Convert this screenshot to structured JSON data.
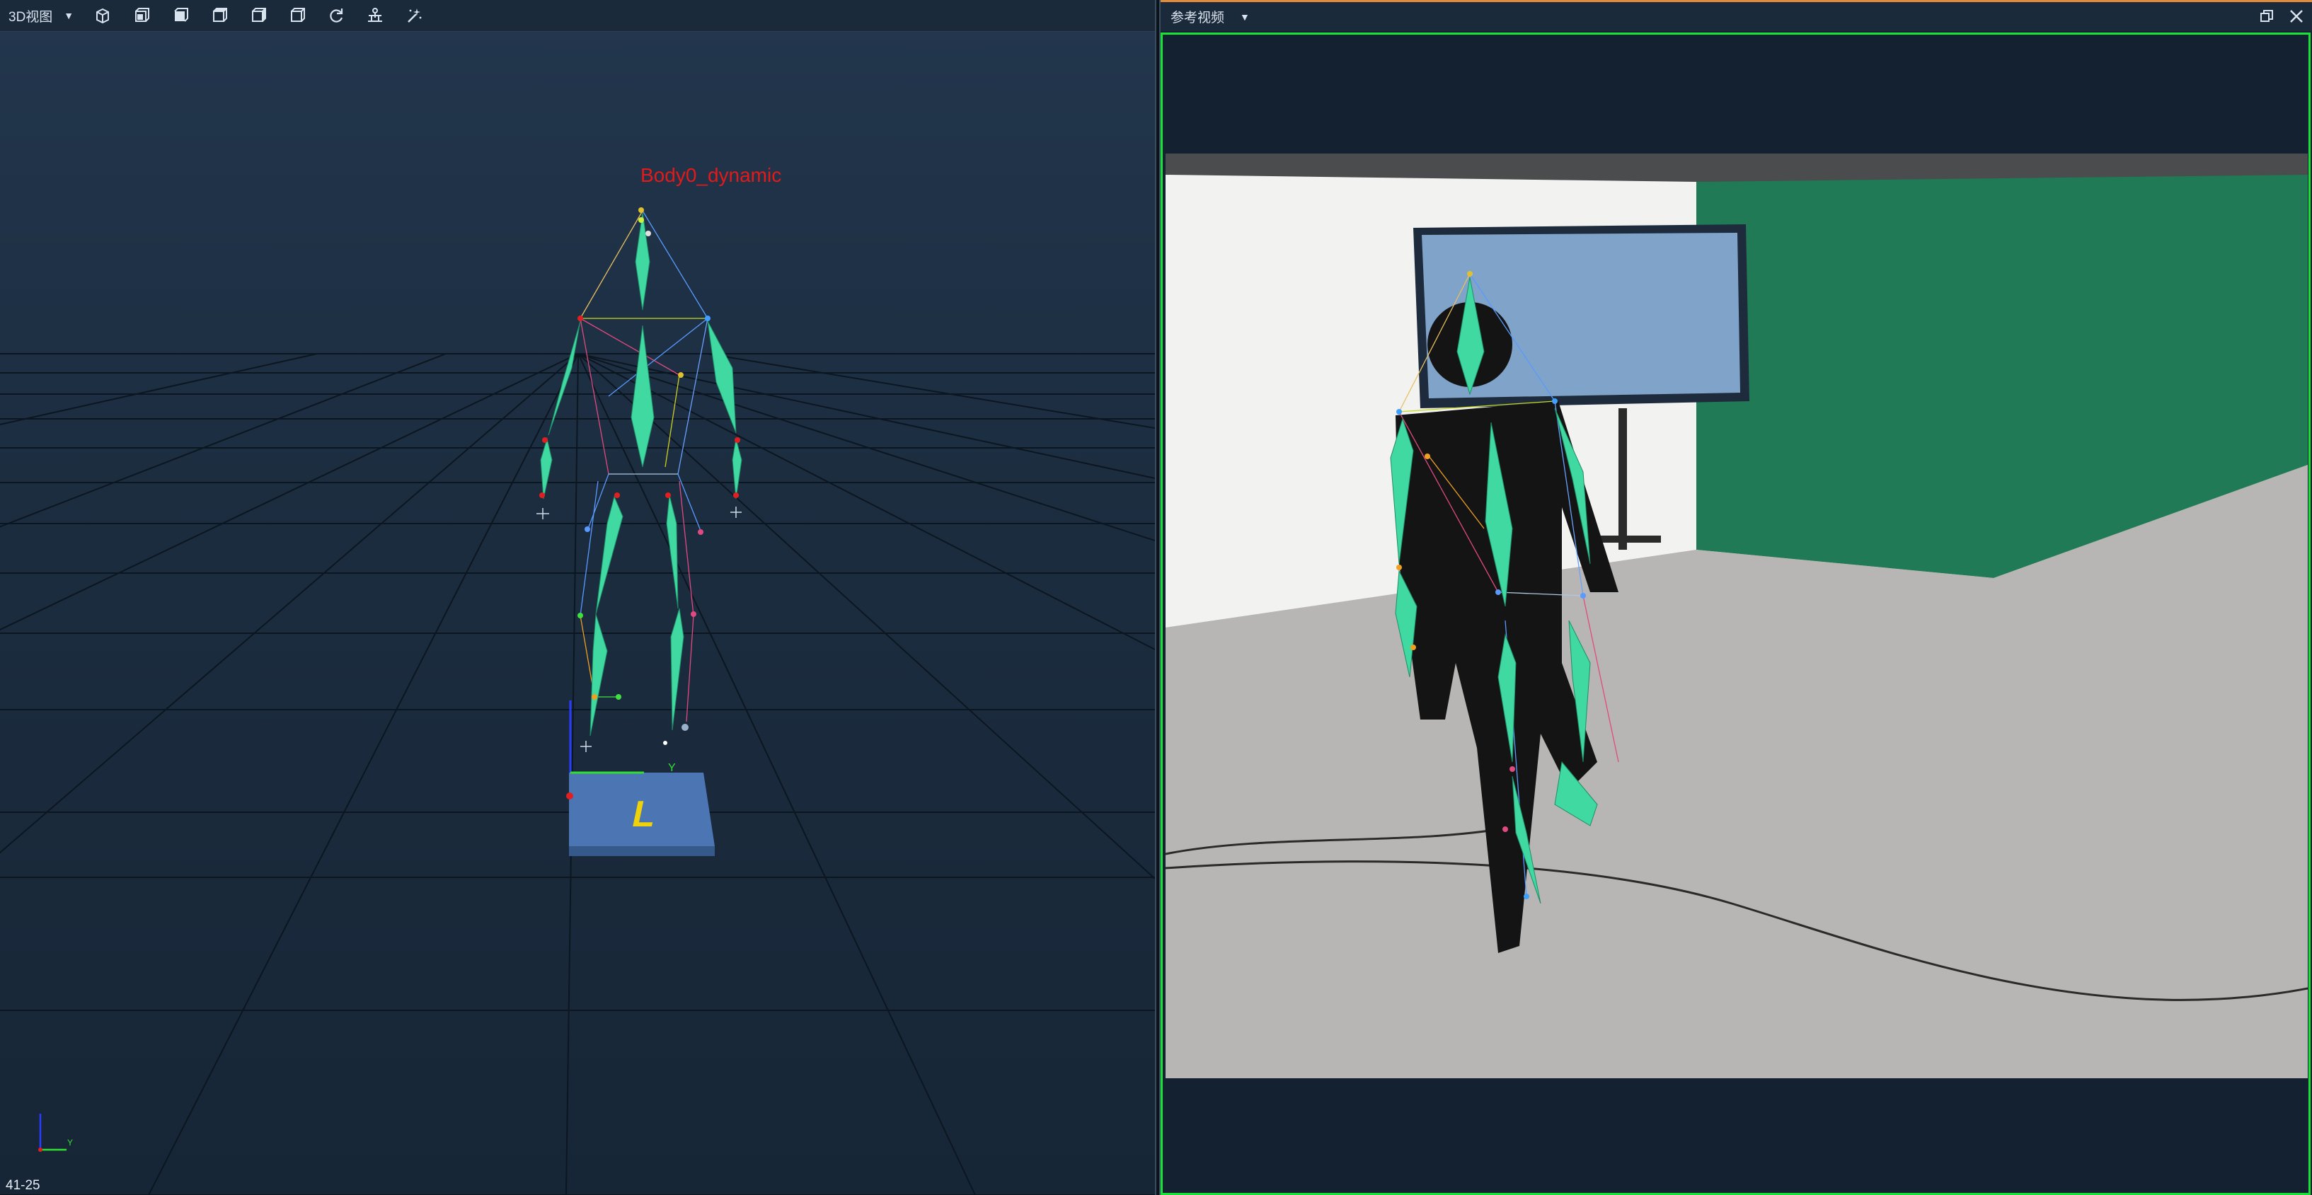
{
  "left_pane": {
    "view_selector": "3D视图",
    "toolbar_icons": [
      "cube-front-icon",
      "cube-left-icon",
      "cube-top-icon",
      "cube-right-icon",
      "cube-back-icon",
      "cube-iso-icon",
      "refresh-icon",
      "align-icon",
      "magic-wand-icon"
    ],
    "subject_label": "Body0_dynamic",
    "floor_plate_letter": "L",
    "axis_y_label": "Y",
    "mini_axis_y_label": "Y",
    "frame_counter": "41-25",
    "colors": {
      "label": "#e31a1a",
      "bone": "#3fd9a1",
      "plate": "#4b76b3",
      "plate_letter": "#f0d20a"
    }
  },
  "right_pane": {
    "title": "参考视频",
    "header_icons": [
      "restore-window-icon",
      "close-icon"
    ],
    "frame_border_color": "#18e23a"
  }
}
